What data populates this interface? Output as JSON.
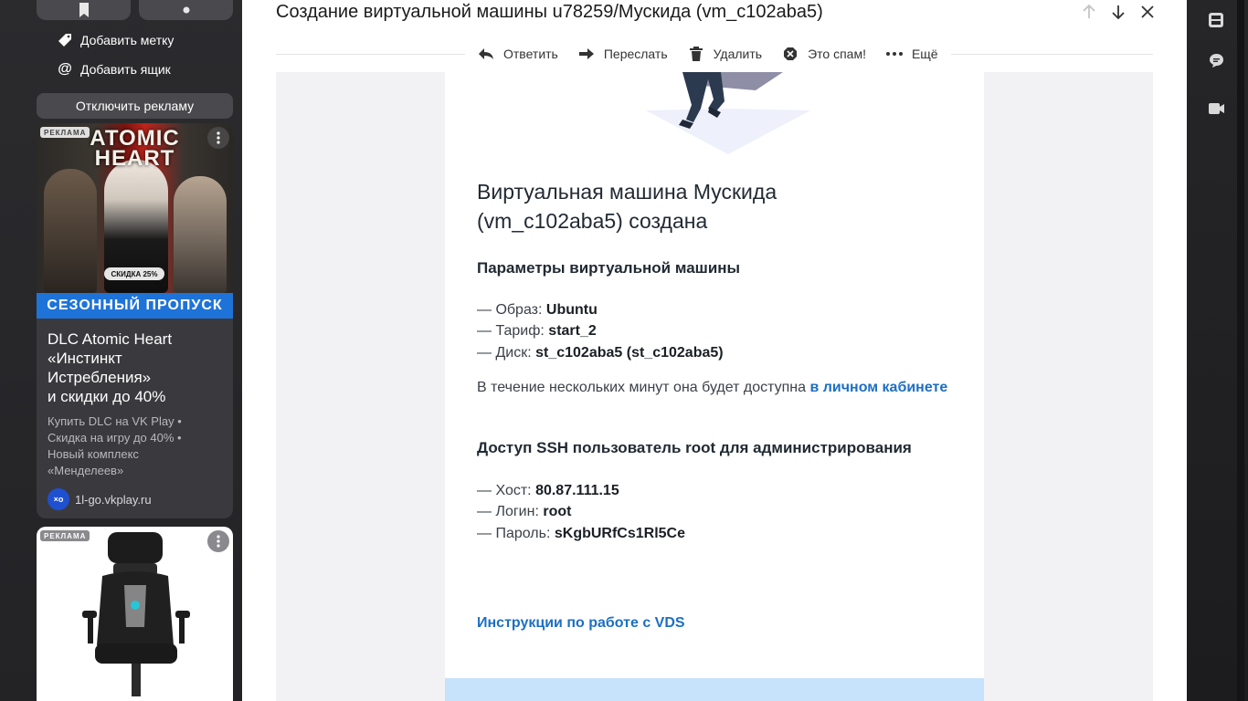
{
  "sidebar": {
    "menu": [
      {
        "label": "Добавить метку",
        "icon": "tag-icon"
      },
      {
        "label": "Добавить ящик",
        "icon": "at-icon"
      }
    ],
    "disable_ads_label": "Отключить рекламу",
    "ad1": {
      "badge": "РЕКЛАМА",
      "game_title_line1": "ATOMIC",
      "game_title_line2": "HEART",
      "discount_pill": "СКИДКА 25%",
      "season_strip": "СЕЗОННЫЙ ПРОПУСК",
      "headline": "DLC Atomic Heart\n«Инстинкт\nИстребления»\nи скидки до 40%",
      "description": "Купить DLC на VK Play •\nСкидка на игру до 40% •\nНовый комплекс\n«Менделеев»",
      "domain": "1l-go.vkplay.ru",
      "domain_logo_text": "×o"
    },
    "ad2": {
      "badge": "РЕКЛАМА"
    }
  },
  "mail": {
    "subject": "Создание виртуальной машины u78259/Мускида (vm_c102aba5)",
    "toolbar": [
      {
        "label": "Ответить",
        "icon": "reply-icon"
      },
      {
        "label": "Переслать",
        "icon": "forward-icon"
      },
      {
        "label": "Удалить",
        "icon": "trash-icon"
      },
      {
        "label": "Это спам!",
        "icon": "spam-icon"
      },
      {
        "label": "Ещё",
        "icon": "more-dots-icon"
      }
    ],
    "body": {
      "heading": "Виртуальная машина Мускида\n(vm_c102aba5) создана",
      "params_title": "Параметры виртуальной машины",
      "params": [
        {
          "label": "— Образ: ",
          "value": "Ubuntu"
        },
        {
          "label": "— Тариф: ",
          "value": "start_2"
        },
        {
          "label": "— Диск: ",
          "value": "st_c102aba5 (st_c102aba5)"
        }
      ],
      "availability_text": "В течение нескольких минут она будет доступна ",
      "availability_link": "в личном кабинете",
      "ssh_title": "Доступ SSH пользователь root для администрирования",
      "ssh": [
        {
          "label": "— Хост: ",
          "value": "80.87.111.15"
        },
        {
          "label": "— Логин: ",
          "value": "root"
        },
        {
          "label": "— Пароль: ",
          "value": "sKgbURfCs1Rl5Ce"
        }
      ],
      "instructions_link": "Инструкции по работе с VDS"
    }
  },
  "colors": {
    "link": "#1d6fc4",
    "season_strip": "#1e73d8",
    "footer_band": "#c7e2fb"
  }
}
